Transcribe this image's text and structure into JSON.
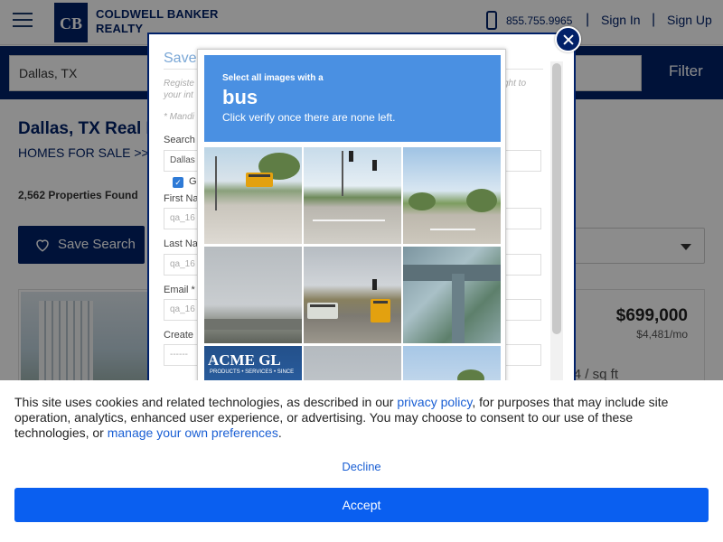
{
  "header": {
    "brand_line1": "COLDWELL BANKER",
    "brand_line2": "REALTY",
    "logo_letters": "CB",
    "phone": "855.755.9965",
    "sign_in": "Sign In",
    "sign_up": "Sign Up",
    "separator": "|"
  },
  "search": {
    "location_value": "Dallas, TX",
    "filter_label": "Filter"
  },
  "results": {
    "title": "Dallas, TX Real E",
    "breadcrumb": "HOMES FOR SALE  >>  C",
    "count": "2,562 Properties Found",
    "save_search_label": "Save Search"
  },
  "listing": {
    "price": "$699,000",
    "monthly": "$4,481/mo",
    "sqft": "4 / sq ft"
  },
  "modal": {
    "title": "Save",
    "intro_left": "Registe",
    "intro_left_line2": "your int",
    "intro_right": "ght to",
    "mandatory": "* Mandi",
    "search_label": "Search",
    "search_value": "Dallas",
    "checkbox_label": "Ge",
    "first_name_label": "First Na",
    "first_name_value": "qa_16",
    "last_name_label": "Last Na",
    "last_name_value": "qa_16",
    "email_label": "Email *",
    "email_value": "qa_16",
    "create_label": "Create",
    "create_value": "------"
  },
  "captcha": {
    "select_text": "Select all images with a",
    "target": "bus",
    "hint": "Click verify once there are none left.",
    "acme_text": "ACME GL",
    "acme_sub": "PRODUCTS • SERVICES • SINCE"
  },
  "cookie": {
    "text_1": "This site uses cookies and related technologies, as described in our ",
    "privacy_link": "privacy policy",
    "text_2": ", for purposes that may include site operation, analytics, enhanced user experience, or advertising. You may choose to consent to our use of these technologies, or ",
    "preferences_link": "manage your own preferences",
    "text_3": ".",
    "decline": "Decline",
    "accept": "Accept"
  },
  "colors": {
    "brand_navy": "#012169",
    "captcha_blue": "#4a90e2",
    "accept_blue": "#0a5ff0",
    "link_blue": "#1a5fd4"
  }
}
